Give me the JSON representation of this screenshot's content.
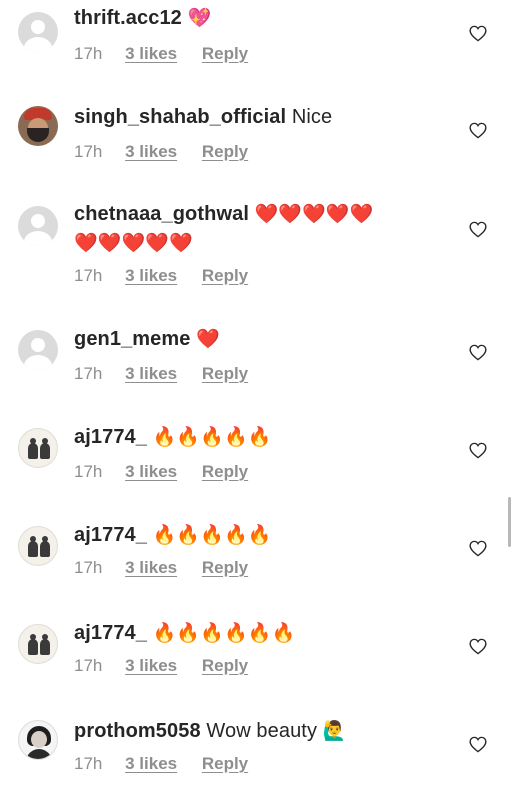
{
  "comments": [
    {
      "username": "thrift.acc12",
      "text": "",
      "emoji": "💖",
      "emoji_icon": "sparkling-heart-icon",
      "time": "17h",
      "likes": "3 likes",
      "reply": "Reply",
      "avatar": "default-avatar"
    },
    {
      "username": "singh_shahab_official",
      "text": "Nice",
      "emoji": "",
      "time": "17h",
      "likes": "3 likes",
      "reply": "Reply",
      "avatar": "photo-avatar"
    },
    {
      "username": "chetnaaa_gothwal",
      "text": "",
      "emoji": "❤️❤️❤️❤️❤️",
      "emoji_line2": "❤️❤️❤️❤️❤️",
      "emoji_icon": "red-heart-icon",
      "time": "17h",
      "likes": "3 likes",
      "reply": "Reply",
      "avatar": "default-avatar"
    },
    {
      "username": "gen1_meme",
      "text": "",
      "emoji": "❤️",
      "emoji_icon": "red-heart-icon",
      "time": "17h",
      "likes": "3 likes",
      "reply": "Reply",
      "avatar": "default-avatar"
    },
    {
      "username": "aj1774_",
      "text": "",
      "emoji": "🔥🔥🔥🔥🔥",
      "emoji_icon": "fire-icon",
      "time": "17h",
      "likes": "3 likes",
      "reply": "Reply",
      "avatar": "photo-avatar"
    },
    {
      "username": "aj1774_",
      "text": "",
      "emoji": "🔥🔥🔥🔥🔥",
      "emoji_icon": "fire-icon",
      "time": "17h",
      "likes": "3 likes",
      "reply": "Reply",
      "avatar": "photo-avatar"
    },
    {
      "username": "aj1774_",
      "text": "",
      "emoji": "🔥🔥🔥🔥🔥🔥",
      "emoji_icon": "fire-icon",
      "time": "17h",
      "likes": "3 likes",
      "reply": "Reply",
      "avatar": "photo-avatar"
    },
    {
      "username": "prothom5058",
      "text": "Wow beauty",
      "emoji": "🙋‍♂️",
      "emoji_icon": "person-raising-hand-icon",
      "time": "17h",
      "likes": "3 likes",
      "reply": "Reply",
      "avatar": "photo-avatar"
    }
  ],
  "like_icon": "heart-outline-icon",
  "colors": {
    "text": "#262626",
    "meta": "#8e8e8e",
    "avatar_placeholder": "#dbdbdb",
    "background": "#ffffff"
  }
}
